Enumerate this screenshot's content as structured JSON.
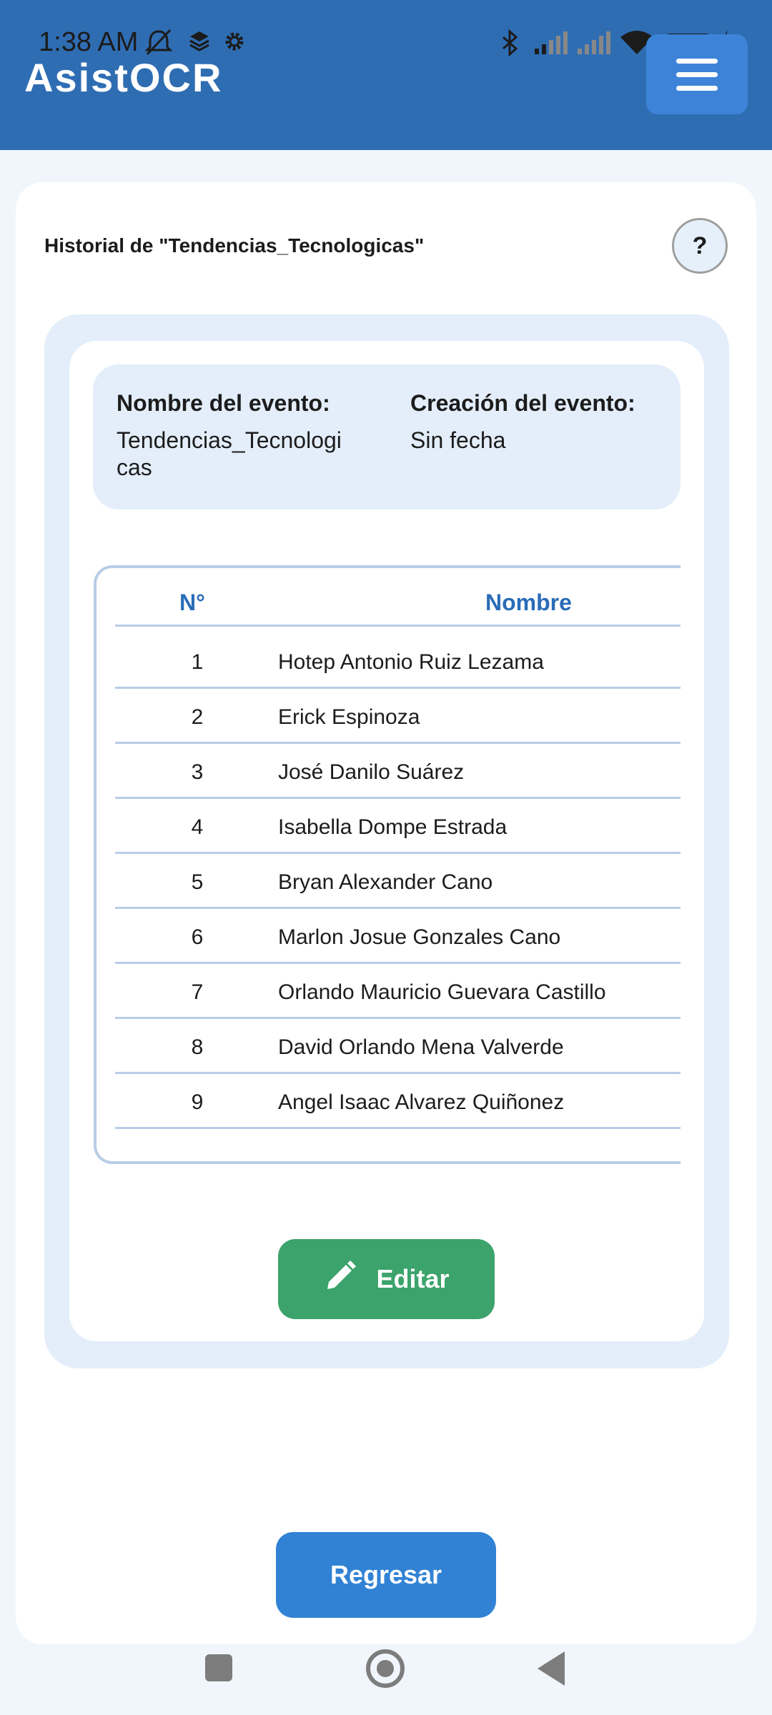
{
  "status_bar": {
    "time": "1:38 AM",
    "battery": "100",
    "icons": [
      "muted-notification-icon",
      "layers-icon",
      "gear-icon",
      "bluetooth-icon",
      "signal-icon",
      "signal-icon",
      "wifi-icon",
      "battery-icon",
      "charging-icon"
    ]
  },
  "header": {
    "app_name": "AsistOCR",
    "menu_icon": "hamburger-menu-icon"
  },
  "page": {
    "title": "Historial de \"Tendencias_Tecnologicas\"",
    "help_label": "?"
  },
  "event_info": {
    "name_label": "Nombre del evento:",
    "name_value_line1": "Tendencias_Tecnologi",
    "name_value_line2": "cas",
    "created_label": "Creación del evento:",
    "created_value": "Sin fecha"
  },
  "table": {
    "headers": [
      "N°",
      "Nombre"
    ],
    "rows": [
      {
        "num": "1",
        "name": "Hotep Antonio Ruiz Lezama"
      },
      {
        "num": "2",
        "name": "Erick Espinoza"
      },
      {
        "num": "3",
        "name": "José Danilo Suárez"
      },
      {
        "num": "4",
        "name": "Isabella Dompe Estrada"
      },
      {
        "num": "5",
        "name": "Bryan Alexander Cano"
      },
      {
        "num": "6",
        "name": "Marlon Josue Gonzales Cano"
      },
      {
        "num": "7",
        "name": "Orlando Mauricio Guevara Castillo"
      },
      {
        "num": "8",
        "name": "David Orlando Mena Valverde"
      },
      {
        "num": "9",
        "name": "Angel Isaac Alvarez Quiñonez"
      }
    ]
  },
  "actions": {
    "edit_label": "Editar",
    "back_label": "Regresar"
  },
  "colors": {
    "header_bg": "#2f6db3",
    "accent_blue": "#3182d4",
    "edit_green": "#3ba36b",
    "panel_bg": "#e3eefa"
  }
}
